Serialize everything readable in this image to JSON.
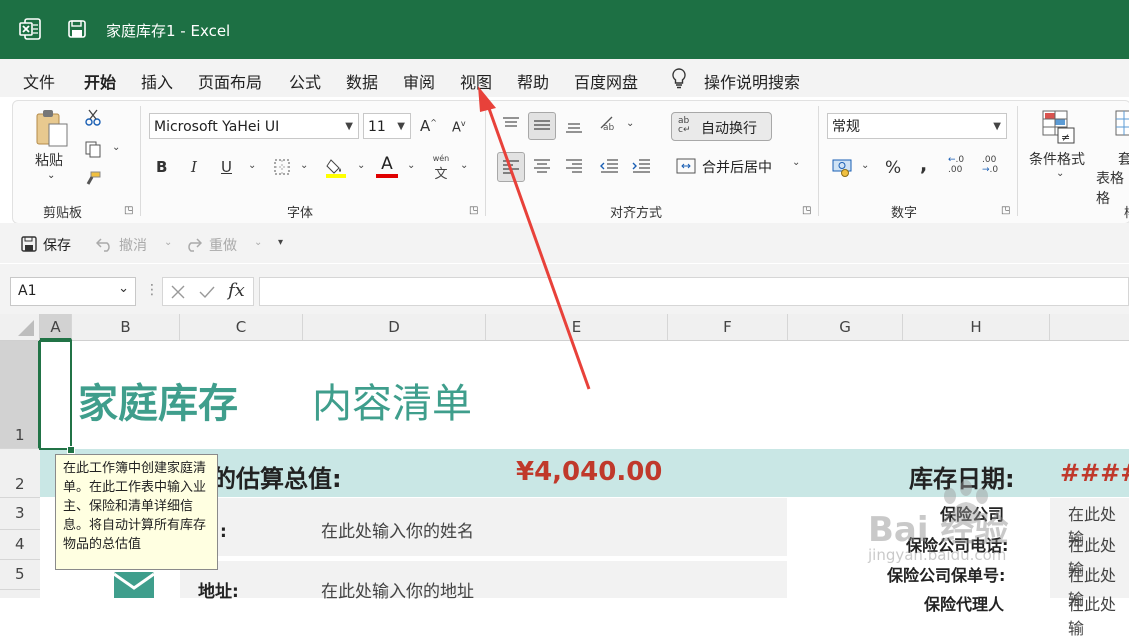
{
  "window": {
    "title": "家庭库存1  -  Excel"
  },
  "menu": [
    "文件",
    "开始",
    "插入",
    "页面布局",
    "公式",
    "数据",
    "审阅",
    "视图",
    "帮助",
    "百度网盘"
  ],
  "search_label": "操作说明搜索",
  "ribbon": {
    "clipboard": {
      "paste": "粘贴",
      "group": "剪贴板"
    },
    "font": {
      "name": "Microsoft YaHei UI",
      "size": "11",
      "group": "字体",
      "bold": "B",
      "italic": "I",
      "underline": "U",
      "color_glyph": "A",
      "phonetic": "wén",
      "grow": "A",
      "shrink": "A"
    },
    "align": {
      "wrap": "自动换行",
      "merge": "合并后居中",
      "group": "对齐方式"
    },
    "number": {
      "format": "常规",
      "group": "数字",
      "percent": "%",
      "comma": ",",
      "inc": ".00",
      "dec": ".00"
    },
    "styles": {
      "conditional": "条件格式",
      "table_a": "套",
      "table_b": "表格格"
    }
  },
  "qat": {
    "save": "保存",
    "undo": "撤消",
    "redo": "重做"
  },
  "formula_bar": {
    "name_box": "A1",
    "fx": "fx",
    "content": ""
  },
  "columns": [
    "A",
    "B",
    "C",
    "D",
    "E",
    "F",
    "G",
    "H"
  ],
  "rows": [
    "1",
    "2",
    "3",
    "4",
    "5"
  ],
  "sheet": {
    "title_a": "家庭库存",
    "title_b": "内容清单",
    "total_label": "的估算总值:",
    "total_value": "¥4,040.00",
    "date_label": "库存日期:",
    "date_value": "####",
    "name_label": "名:",
    "name_value": "在此处输入你的姓名",
    "address_label": "地址:",
    "address_value": "在此处输入你的地址",
    "ins_company": "保险公司",
    "ins_phone": "保险公司电话:",
    "ins_policy": "保险公司保单号:",
    "ins_agent": "保险代理人",
    "ins_value_1": "在此处输",
    "ins_value_2": "在此处输",
    "ins_value_3": "在此处输",
    "ins_value_4": "在此处输"
  },
  "tooltip": "在此工作簿中创建家庭清单。在此工作表中输入业主、保险和清单详细信息。将自动计算所有库存物品的总估值",
  "watermark": {
    "main": "Bai 经验",
    "sub": "jingyan.baidu.com"
  },
  "colors": {
    "excel_green": "#1d7044",
    "teal": "#3f9e8c",
    "band": "#c9e7e5",
    "accent_red": "#c0392b",
    "annotation_arrow": "#e8413a"
  }
}
